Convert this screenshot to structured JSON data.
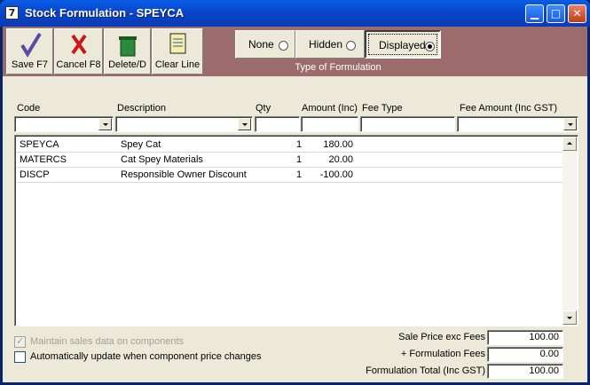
{
  "window": {
    "title": "Stock Formulation - SPEYCA",
    "app_icon": "7"
  },
  "toolbar": {
    "save": "Save F7",
    "cancel": "Cancel F8",
    "delete": "Delete/D",
    "clear": "Clear Line"
  },
  "formulation_type": {
    "caption": "Type of Formulation",
    "options": [
      {
        "label": "None",
        "selected": false
      },
      {
        "label": "Hidden",
        "selected": false
      },
      {
        "label": "Displayed",
        "selected": true
      }
    ]
  },
  "columns": {
    "code": "Code",
    "description": "Description",
    "qty": "Qty",
    "amount": "Amount (Inc)",
    "fee_type": "Fee Type",
    "fee_amount": "Fee Amount (Inc GST)"
  },
  "rows": [
    {
      "code": "SPEYCA",
      "description": "Spey Cat",
      "qty": "1",
      "amount": "180.00"
    },
    {
      "code": "MATERCS",
      "description": "Cat Spey Materials",
      "qty": "1",
      "amount": "20.00"
    },
    {
      "code": "DISCP",
      "description": "Responsible Owner Discount",
      "qty": "1",
      "amount": "-100.00"
    }
  ],
  "options": {
    "maintain_sales": "Maintain sales data on components",
    "auto_update": "Automatically update when component price changes"
  },
  "totals": {
    "sale_price_label": "Sale Price exc Fees",
    "sale_price_value": "100.00",
    "fees_label": "+ Formulation Fees",
    "fees_value": "0.00",
    "total_label": "Formulation Total (Inc GST)",
    "total_value": "100.00"
  },
  "colors": {
    "toolbar_bg": "#9c6b6b",
    "titlebar": "#0a5ce6"
  }
}
